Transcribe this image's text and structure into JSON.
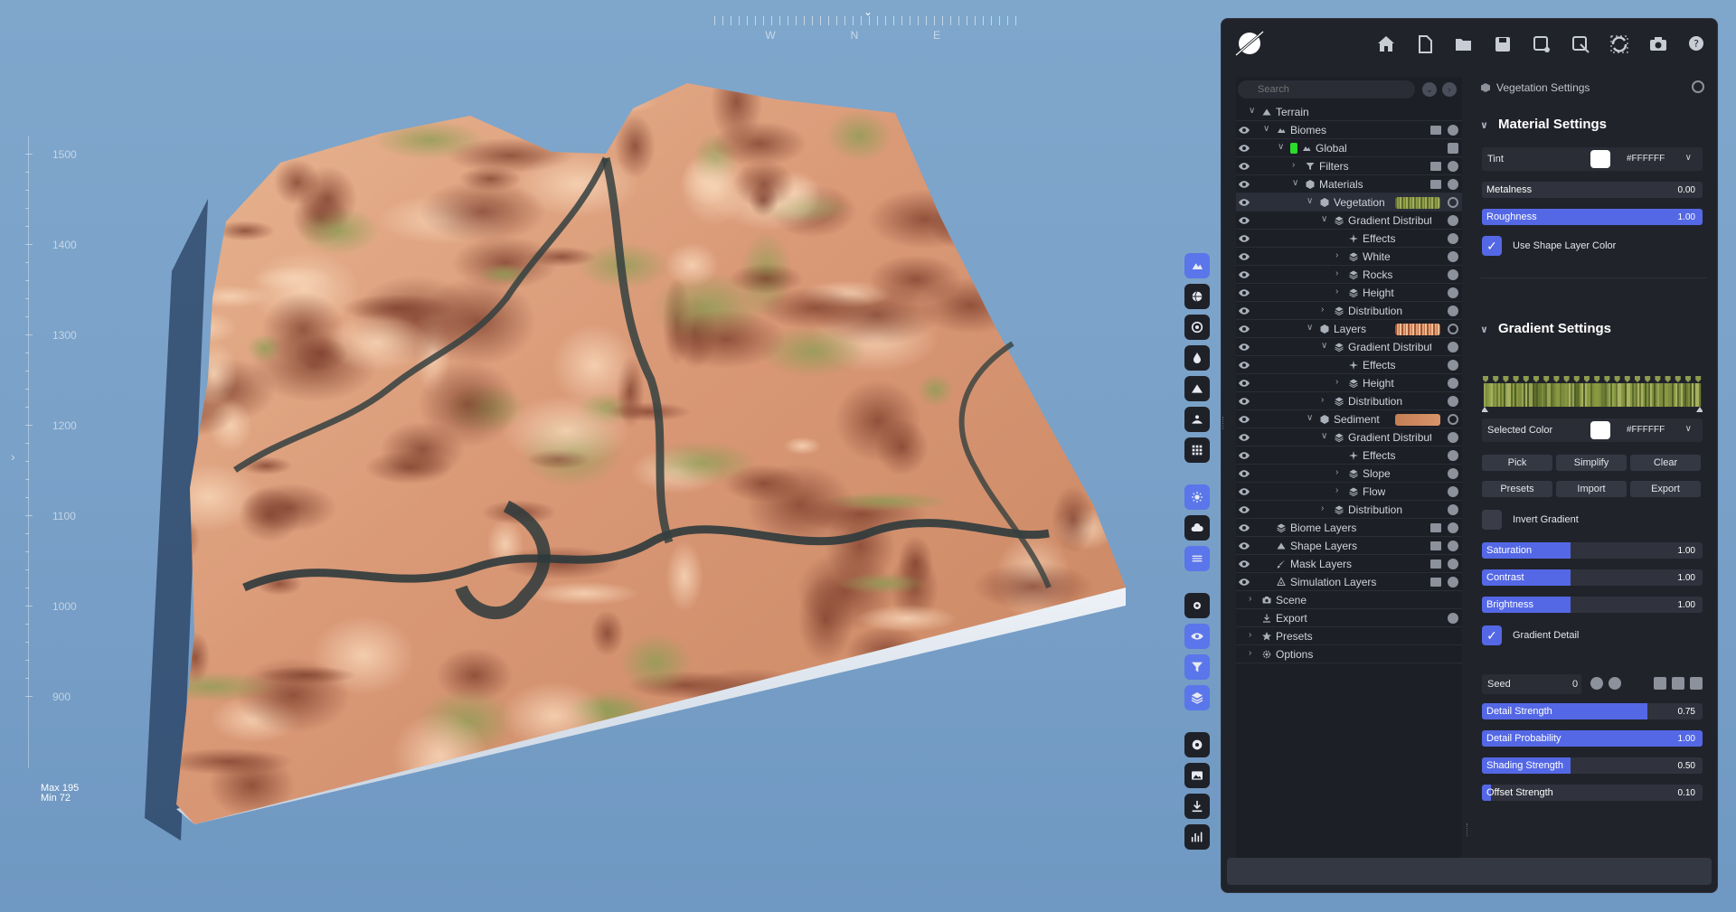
{
  "compass": {
    "west": "W",
    "north": "N",
    "east": "E",
    "marker": "⌄"
  },
  "elevation": {
    "ticks": [
      "1500",
      "1400",
      "1300",
      "1200",
      "1100",
      "1000",
      "900"
    ],
    "max_label": "Max 195",
    "min_label": "Min 72"
  },
  "toolbar": {
    "groups": [
      [
        "biome-icon",
        "globe-icon",
        "target-icon",
        "drop-icon",
        "mountain-icon",
        "landscape-icon",
        "grid-icon"
      ],
      [
        "sun-icon",
        "cloud-icon",
        "lines-icon"
      ],
      [
        "settings-cog-icon",
        "view-icon",
        "filter-icon",
        "layers-icon"
      ],
      [
        "record-icon",
        "image-icon",
        "download-icon",
        "stats-icon"
      ]
    ],
    "active": [
      "biome-icon",
      "sun-icon",
      "lines-icon",
      "view-icon",
      "filter-icon",
      "layers-icon"
    ]
  },
  "topbar": {
    "icons": [
      "home-icon",
      "new-file-icon",
      "open-folder-icon",
      "save-icon",
      "save-as-icon",
      "export-file-icon",
      "refresh-icon",
      "camera-icon",
      "help-icon"
    ]
  },
  "tree": {
    "search_placeholder": "Search",
    "rows": [
      {
        "label": "Terrain",
        "depth": 0,
        "icon": "mountain-icon",
        "expanded": true,
        "eye": false,
        "buttons": ""
      },
      {
        "label": "Biomes",
        "depth": 1,
        "icon": "biome-icon",
        "expanded": true,
        "eye": true,
        "buttons": "fa"
      },
      {
        "label": "Global",
        "depth": 2,
        "icon": "biome-icon",
        "expanded": true,
        "eye": true,
        "buttons": "l",
        "swatch": "#2bdc2b"
      },
      {
        "label": "Filters",
        "depth": 3,
        "icon": "filter-icon",
        "expanded": false,
        "eye": true,
        "buttons": "fa"
      },
      {
        "label": "Materials",
        "depth": 3,
        "icon": "cube-icon",
        "expanded": true,
        "eye": true,
        "buttons": "fa"
      },
      {
        "label": "Vegetation",
        "depth": 4,
        "icon": "cube-icon",
        "expanded": true,
        "eye": true,
        "buttons": "r",
        "strip": "veg",
        "selected": true
      },
      {
        "label": "Gradient Distribution",
        "depth": 5,
        "icon": "layers-icon",
        "expanded": true,
        "eye": true,
        "buttons": "a"
      },
      {
        "label": "Effects",
        "depth": 6,
        "icon": "sparkle-icon",
        "expanded": null,
        "eye": true,
        "buttons": "a"
      },
      {
        "label": "White",
        "depth": 6,
        "icon": "layers-icon",
        "expanded": false,
        "eye": true,
        "buttons": "a"
      },
      {
        "label": "Rocks",
        "depth": 6,
        "icon": "layers-icon",
        "expanded": false,
        "eye": true,
        "buttons": "a"
      },
      {
        "label": "Height",
        "depth": 6,
        "icon": "layers-icon",
        "expanded": false,
        "eye": true,
        "buttons": "a"
      },
      {
        "label": "Distribution",
        "depth": 5,
        "icon": "layers-icon",
        "expanded": false,
        "eye": true,
        "buttons": "a"
      },
      {
        "label": "Layers",
        "depth": 4,
        "icon": "cube-icon",
        "expanded": true,
        "eye": true,
        "buttons": "r",
        "strip": "layers"
      },
      {
        "label": "Gradient Distribution",
        "depth": 5,
        "icon": "layers-icon",
        "expanded": true,
        "eye": true,
        "buttons": "a"
      },
      {
        "label": "Effects",
        "depth": 6,
        "icon": "sparkle-icon",
        "expanded": null,
        "eye": true,
        "buttons": "a"
      },
      {
        "label": "Height",
        "depth": 6,
        "icon": "layers-icon",
        "expanded": false,
        "eye": true,
        "buttons": "a"
      },
      {
        "label": "Distribution",
        "depth": 5,
        "icon": "layers-icon",
        "expanded": false,
        "eye": true,
        "buttons": "a"
      },
      {
        "label": "Sediment",
        "depth": 4,
        "icon": "cube-icon",
        "expanded": true,
        "eye": true,
        "buttons": "r",
        "strip": "sediment"
      },
      {
        "label": "Gradient Distribution",
        "depth": 5,
        "icon": "layers-icon",
        "expanded": true,
        "eye": true,
        "buttons": "a"
      },
      {
        "label": "Effects",
        "depth": 6,
        "icon": "sparkle-icon",
        "expanded": null,
        "eye": true,
        "buttons": "a"
      },
      {
        "label": "Slope",
        "depth": 6,
        "icon": "layers-icon",
        "expanded": false,
        "eye": true,
        "buttons": "a"
      },
      {
        "label": "Flow",
        "depth": 6,
        "icon": "layers-icon",
        "expanded": false,
        "eye": true,
        "buttons": "a"
      },
      {
        "label": "Distribution",
        "depth": 5,
        "icon": "layers-icon",
        "expanded": false,
        "eye": true,
        "buttons": "a"
      },
      {
        "label": "Biome Layers",
        "depth": 1,
        "icon": "layers-icon",
        "expanded": null,
        "eye": true,
        "buttons": "fa"
      },
      {
        "label": "Shape Layers",
        "depth": 1,
        "icon": "mountain-icon",
        "expanded": null,
        "eye": true,
        "buttons": "fa"
      },
      {
        "label": "Mask Layers",
        "depth": 1,
        "icon": "brush-icon",
        "expanded": null,
        "eye": true,
        "buttons": "fa"
      },
      {
        "label": "Simulation Layers",
        "depth": 1,
        "icon": "simulation-icon",
        "expanded": null,
        "eye": true,
        "buttons": "fa"
      },
      {
        "label": "Scene",
        "depth": 0,
        "icon": "camera-icon",
        "expanded": false,
        "eye": false,
        "buttons": ""
      },
      {
        "label": "Export",
        "depth": 0,
        "icon": "download-icon",
        "expanded": null,
        "eye": false,
        "buttons": "a"
      },
      {
        "label": "Presets",
        "depth": 0,
        "icon": "star-icon",
        "expanded": false,
        "eye": false,
        "buttons": ""
      },
      {
        "label": "Options",
        "depth": 0,
        "icon": "gear-icon",
        "expanded": false,
        "eye": false,
        "buttons": ""
      }
    ]
  },
  "settings": {
    "header": "Vegetation Settings",
    "material": {
      "title": "Material Settings",
      "tint_label": "Tint",
      "tint_hex": "#FFFFFF",
      "metalness": {
        "label": "Metalness",
        "value": "0.00",
        "fraction": 0.0
      },
      "roughness": {
        "label": "Roughness",
        "value": "1.00",
        "fraction": 1.0
      },
      "use_shape_color": {
        "label": "Use Shape Layer Color",
        "checked": true
      }
    },
    "gradient": {
      "title": "Gradient Settings",
      "selected_color_label": "Selected Color",
      "selected_hex": "#FFFFFF",
      "buttons_row1": [
        "Pick",
        "Simplify",
        "Clear"
      ],
      "buttons_row2": [
        "Presets",
        "Import",
        "Export"
      ],
      "invert": {
        "label": "Invert Gradient",
        "checked": false
      },
      "saturation": {
        "label": "Saturation",
        "value": "1.00",
        "fraction": 0.4
      },
      "contrast": {
        "label": "Contrast",
        "value": "1.00",
        "fraction": 0.4
      },
      "brightness": {
        "label": "Brightness",
        "value": "1.00",
        "fraction": 0.4
      },
      "detail": {
        "label": "Gradient Detail",
        "checked": true
      },
      "seed": {
        "label": "Seed",
        "value": "0"
      },
      "detail_strength": {
        "label": "Detail Strength",
        "value": "0.75",
        "fraction": 0.75
      },
      "detail_probability": {
        "label": "Detail Probability",
        "value": "1.00",
        "fraction": 1.0
      },
      "shading_strength": {
        "label": "Shading Strength",
        "value": "0.50",
        "fraction": 0.4
      },
      "offset_strength": {
        "label": "Offset Strength",
        "value": "0.10",
        "fraction": 0.04
      }
    }
  },
  "colors": {
    "accent": "#5468e6",
    "panel_bg": "#21232b",
    "sky": "#7aa1c8",
    "terrain_light": "#e4ad86",
    "terrain_dark": "#8a4a36",
    "vegetation": "#8a9a52",
    "river": "#2c3b3e",
    "base_side": "#dbe3ee"
  }
}
